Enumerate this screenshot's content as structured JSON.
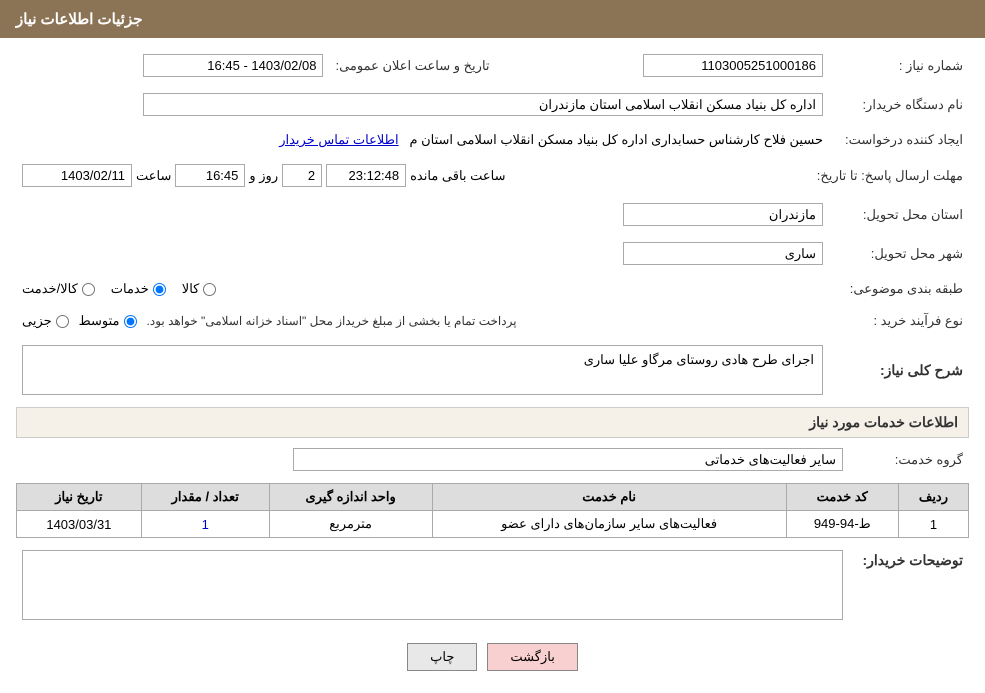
{
  "header": {
    "title": "جزئیات اطلاعات نیاز"
  },
  "fields": {
    "shomara_niaz_label": "شماره نیاز :",
    "shomara_niaz_value": "1103005251000186",
    "tarikhAelan_label": "تاریخ و ساعت اعلان عمومی:",
    "tarikhAelan_value": "1403/02/08 - 16:45",
    "nam_dastgah_label": "نام دستگاه خریدار:",
    "nam_dastgah_value": "اداره کل بنیاد مسکن انقلاب اسلامی استان مازندران",
    "ijad_label": "ایجاد کننده درخواست:",
    "ijad_value": "حسین فلاح کارشناس حسابداری اداره کل بنیاد مسکن انقلاب اسلامی استان م",
    "ijad_link": "اطلاعات تماس خریدار",
    "mohlat_label": "مهلت ارسال پاسخ: تا تاریخ:",
    "mohlat_date": "1403/02/11",
    "mohlat_saat_label": "ساعت",
    "mohlat_saat_value": "16:45",
    "mohlat_roz_label": "روز و",
    "mohlat_roz_value": "2",
    "mohlat_baqi_value": "23:12:48",
    "mohlat_baqi_label": "ساعت باقی مانده",
    "ostan_label": "استان محل تحویل:",
    "ostan_value": "مازندران",
    "shahr_label": "شهر محل تحویل:",
    "shahr_value": "ساری",
    "tabaqa_label": "طبقه بندی موضوعی:",
    "radio_kala": "کالا",
    "radio_khadamat": "خدمات",
    "radio_kala_khadamat": "کالا/خدمت",
    "radio_khadamat_selected": true,
    "noePa_label": "نوع فرآیند خرید :",
    "radio_jazei": "جزیی",
    "radio_motevaset": "متوسط",
    "noePa_desc": "پرداخت تمام یا بخشی از مبلغ خریداز محل \"اسناد خزانه اسلامی\" خواهد بود.",
    "sharh_label": "شرح کلی نیاز:",
    "sharh_value": "اجرای طرح هادی روستای مرگاو علیا ساری",
    "khadamat_label": "اطلاعات خدمات مورد نیاز",
    "grooh_label": "گروه خدمت:",
    "grooh_value": "سایر فعالیت‌های خدماتی",
    "table": {
      "headers": [
        "ردیف",
        "کد خدمت",
        "نام خدمت",
        "واحد اندازه گیری",
        "تعداد / مقدار",
        "تاریخ نیاز"
      ],
      "rows": [
        {
          "radif": "1",
          "kod": "ط-94-949",
          "name": "فعالیت‌های سایر سازمان‌های دارای عضو",
          "vahed": "مترمربع",
          "tedad": "1",
          "tarikh": "1403/03/31"
        }
      ]
    },
    "tosih_label": "توضیحات خریدار:",
    "tosih_value": ""
  },
  "buttons": {
    "chap": "چاپ",
    "bazgasht": "بازگشت"
  }
}
